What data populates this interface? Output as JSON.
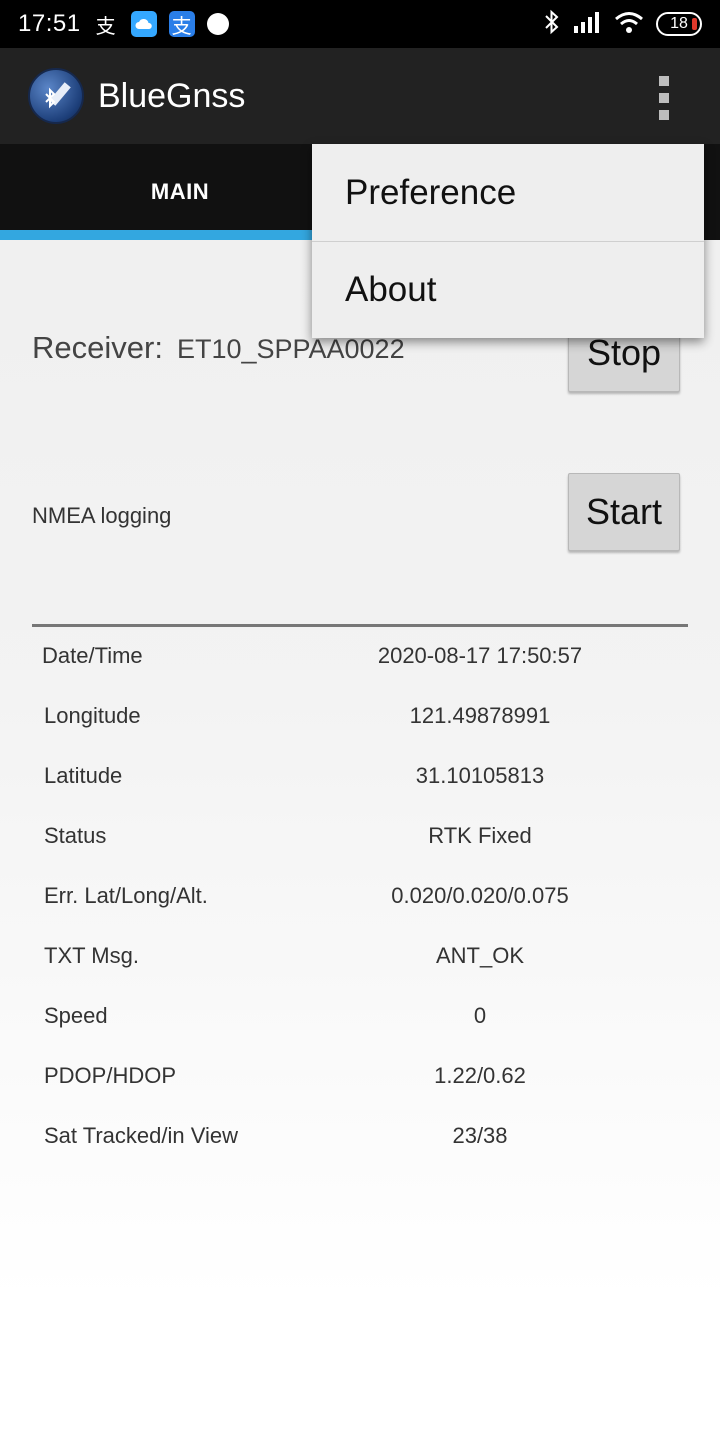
{
  "status_bar": {
    "time": "17:51",
    "icons": [
      "alipay-icon",
      "cloud-icon",
      "alipay-icon",
      "dot-icon"
    ],
    "battery": "18"
  },
  "app_bar": {
    "title": "BlueGnss",
    "logo_icon": "satellite-bluetooth-icon",
    "menu_icon": "overflow-menu-icon"
  },
  "tabs": {
    "main_label": "MAIN",
    "indicator_color": "#33a7e0"
  },
  "receiver": {
    "label": "Receiver:",
    "value": "ET10_SPPAA0022",
    "stop_label": "Stop"
  },
  "nmea": {
    "label": "NMEA logging",
    "start_label": "Start"
  },
  "info": [
    {
      "label": "Date/Time",
      "value": "2020-08-17 17:50:57"
    },
    {
      "label": "Longitude",
      "value": "121.49878991"
    },
    {
      "label": "Latitude",
      "value": "31.10105813"
    },
    {
      "label": "Status",
      "value": "RTK Fixed"
    },
    {
      "label": "Err. Lat/Long/Alt.",
      "value": "0.020/0.020/0.075"
    },
    {
      "label": "TXT Msg.",
      "value": "ANT_OK"
    },
    {
      "label": "Speed",
      "value": "0"
    },
    {
      "label": "PDOP/HDOP",
      "value": "1.22/0.62"
    },
    {
      "label": "Sat Tracked/in View",
      "value": "23/38"
    }
  ],
  "menu": {
    "items": [
      "Preference",
      "About"
    ]
  }
}
